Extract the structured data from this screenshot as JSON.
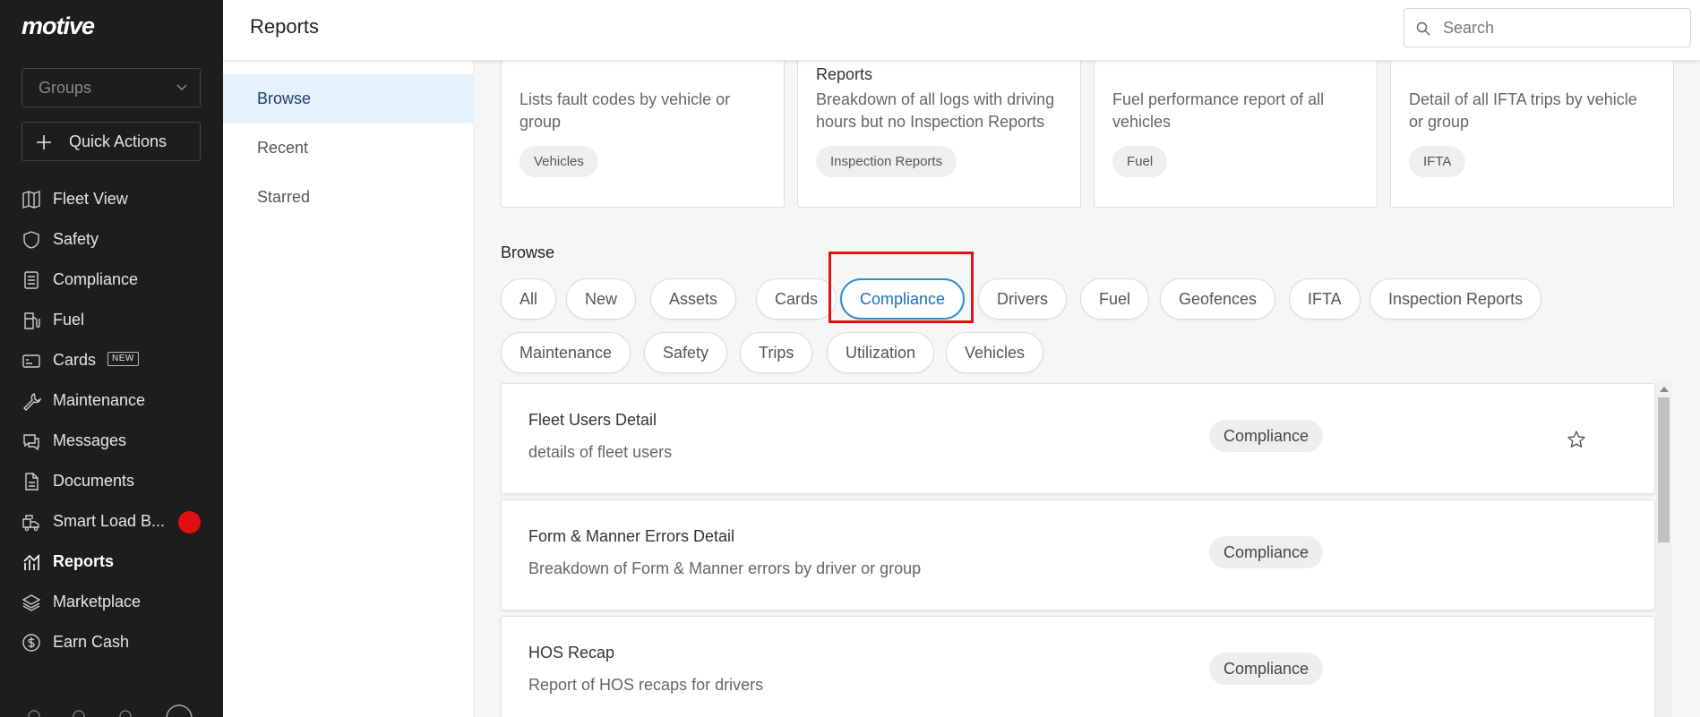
{
  "app": {
    "logo_text": "motive"
  },
  "sidebar": {
    "groups_placeholder": "Groups",
    "quick_actions_label": "Quick Actions",
    "items": [
      {
        "label": "Fleet View",
        "icon": "map-icon"
      },
      {
        "label": "Safety",
        "icon": "shield-icon"
      },
      {
        "label": "Compliance",
        "icon": "document-list-icon"
      },
      {
        "label": "Fuel",
        "icon": "fuel-pump-icon"
      },
      {
        "label": "Cards",
        "icon": "card-icon",
        "badge": "NEW"
      },
      {
        "label": "Maintenance",
        "icon": "wrench-icon"
      },
      {
        "label": "Messages",
        "icon": "chat-icon"
      },
      {
        "label": "Documents",
        "icon": "file-icon"
      },
      {
        "label": "Smart Load B...",
        "icon": "truck-load-icon"
      },
      {
        "label": "Reports",
        "icon": "reports-chart-icon",
        "active": true
      },
      {
        "label": "Marketplace",
        "icon": "layers-icon"
      },
      {
        "label": "Earn Cash",
        "icon": "dollar-circle-icon"
      }
    ]
  },
  "header": {
    "title": "Reports",
    "search_placeholder": "Search"
  },
  "subnav": {
    "items": [
      {
        "label": "Browse",
        "active": true
      },
      {
        "label": "Recent"
      },
      {
        "label": "Starred"
      }
    ]
  },
  "cards": [
    {
      "title": "",
      "desc": "Lists fault codes by vehicle or group",
      "tag": "Vehicles"
    },
    {
      "title": "Reports",
      "desc": "Breakdown of all logs with driving hours but no Inspection Reports",
      "tag": "Inspection Reports"
    },
    {
      "title": "",
      "desc": "Fuel performance report of all vehicles",
      "tag": "Fuel"
    },
    {
      "title": "",
      "desc": "Detail of all IFTA trips by vehicle or group",
      "tag": "IFTA"
    }
  ],
  "browse": {
    "label": "Browse",
    "chips": [
      "All",
      "New",
      "Assets",
      "Cards",
      "Compliance",
      "Drivers",
      "Fuel",
      "Geofences",
      "IFTA",
      "Inspection Reports",
      "Maintenance",
      "Safety",
      "Trips",
      "Utilization",
      "Vehicles"
    ],
    "selected": "Compliance"
  },
  "reports": [
    {
      "title": "Fleet Users Detail",
      "desc": "details of fleet users",
      "tag": "Compliance",
      "star": "star-outline-icon"
    },
    {
      "title": "Form & Manner Errors Detail",
      "desc": "Breakdown of Form & Manner errors by driver or group",
      "tag": "Compliance"
    },
    {
      "title": "HOS Recap",
      "desc": "Report of HOS recaps for drivers",
      "tag": "Compliance"
    }
  ],
  "colors": {
    "sidebar_bg": "#1d1d1d",
    "accent": "#2b8fd6",
    "highlight": "#e01313",
    "notification_dot": "#e01010",
    "subnav_active_bg": "#e5f1fb"
  }
}
